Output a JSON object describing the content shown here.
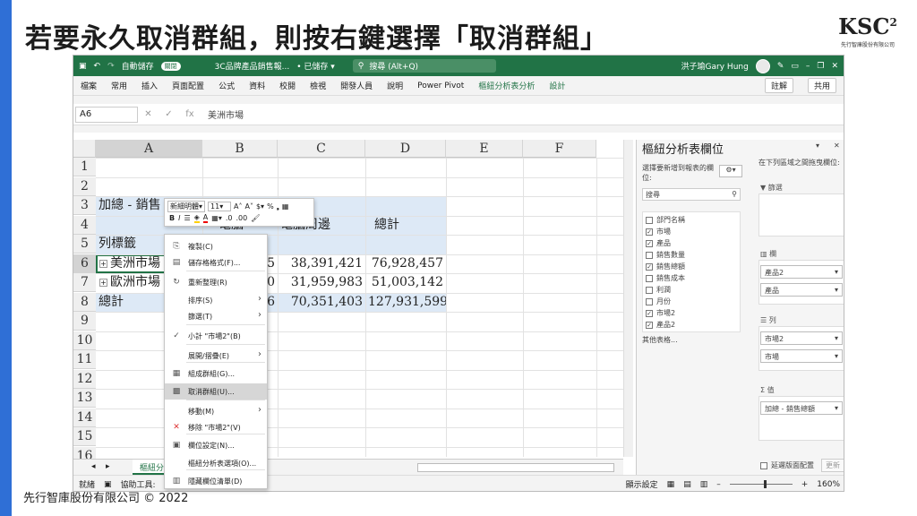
{
  "slide": {
    "title": "若要永久取消群組，則按右鍵選擇「取消群組」",
    "logo_mark": "KSC",
    "logo_sup": "2",
    "logo_sub": "先行智庫股份有限公司",
    "footer": "先行智庫股份有限公司 © 2022"
  },
  "titlebar": {
    "autosave_label": "自動儲存",
    "autosave_state": "關閉",
    "filename": "3C品牌產品銷售報...",
    "saved": "• 已儲存 ▾",
    "search_placeholder": "搜尋 (Alt+Q)",
    "user": "洪子瑜Gary Hung"
  },
  "menubar": {
    "items": [
      "檔案",
      "常用",
      "插入",
      "頁面配置",
      "公式",
      "資料",
      "校閱",
      "檢視",
      "開發人員",
      "說明",
      "Power Pivot",
      "樞紐分析表分析",
      "設計"
    ],
    "comment_btn": "註解",
    "share_btn": "共用"
  },
  "formula_bar": {
    "name_box": "A6",
    "fx": "fx",
    "content": "美洲市場"
  },
  "sheet": {
    "columns": [
      "A",
      "B",
      "C",
      "D",
      "E",
      "F"
    ],
    "rows": [
      "1",
      "2",
      "3",
      "4",
      "5",
      "6",
      "7",
      "8",
      "9",
      "10",
      "11",
      "12",
      "13",
      "14",
      "15",
      "16"
    ],
    "r3a": "加總 - 銷售",
    "r4c": "電腦周邊",
    "r4d": "總計",
    "r4b": "電腦",
    "r5a": "列標籤",
    "r6a": "美洲市場",
    "r6b": "5",
    "r6c": "38,391,421",
    "r6d": "76,928,457",
    "r7a": "歐洲市場",
    "r7b": "0",
    "r7c": "31,959,983",
    "r7d": "51,003,142",
    "r8a": "總計",
    "r8b": "6",
    "r8c": "70,351,403",
    "r8d": "127,931,599",
    "tab": "樞紐分"
  },
  "mini_toolbar": {
    "font": "新細明體",
    "size": "11"
  },
  "context_menu": {
    "items": [
      {
        "label": "複製(C)",
        "icon": "⎘"
      },
      {
        "label": "儲存格格式(F)...",
        "icon": "▤"
      },
      {
        "label": "重新整理(R)",
        "icon": "↻"
      },
      {
        "label": "排序(S)",
        "icon": ""
      },
      {
        "label": "篩選(T)",
        "icon": ""
      },
      {
        "label": "小計 \"市場2\"(B)",
        "icon": "✓"
      },
      {
        "label": "展開/摺疊(E)",
        "icon": ""
      },
      {
        "label": "組成群組(G)...",
        "icon": "▦"
      },
      {
        "label": "取消群組(U)...",
        "icon": "▩"
      },
      {
        "label": "移動(M)",
        "icon": ""
      },
      {
        "label": "移除 \"市場2\"(V)",
        "icon": "✕"
      },
      {
        "label": "欄位設定(N)...",
        "icon": "▣"
      },
      {
        "label": "樞紐分析表選項(O)...",
        "icon": ""
      },
      {
        "label": "隱藏欄位清單(D)",
        "icon": "▥"
      }
    ]
  },
  "pivot_pane": {
    "title": "樞紐分析表欄位",
    "choose_label": "選擇要新增到報表的欄位:",
    "drag_label": "在下列區域之間拖曳欄位:",
    "search_placeholder": "搜尋",
    "fields": [
      {
        "name": "部門名稱",
        "checked": false
      },
      {
        "name": "市場",
        "checked": true
      },
      {
        "name": "產品",
        "checked": true
      },
      {
        "name": "銷售數量",
        "checked": false
      },
      {
        "name": "銷售總額",
        "checked": true
      },
      {
        "name": "銷售成本",
        "checked": false
      },
      {
        "name": "利潤",
        "checked": false
      },
      {
        "name": "月份",
        "checked": false
      },
      {
        "name": "市場2",
        "checked": true
      },
      {
        "name": "產品2",
        "checked": true
      }
    ],
    "more_tables": "其他表格...",
    "filter_label": "篩選",
    "columns_label": "欄",
    "columns_items": [
      "產品2",
      "產品"
    ],
    "rows_label": "列",
    "rows_items": [
      "市場2",
      "市場"
    ],
    "values_label": "值",
    "values_items": [
      "加總 - 銷售總額"
    ],
    "defer_label": "延遲版面配置",
    "update_btn": "更新"
  },
  "statusbar": {
    "ready": "就緒",
    "accessibility": "協助工具:",
    "display_settings": "顯示設定",
    "zoom": "160%"
  }
}
